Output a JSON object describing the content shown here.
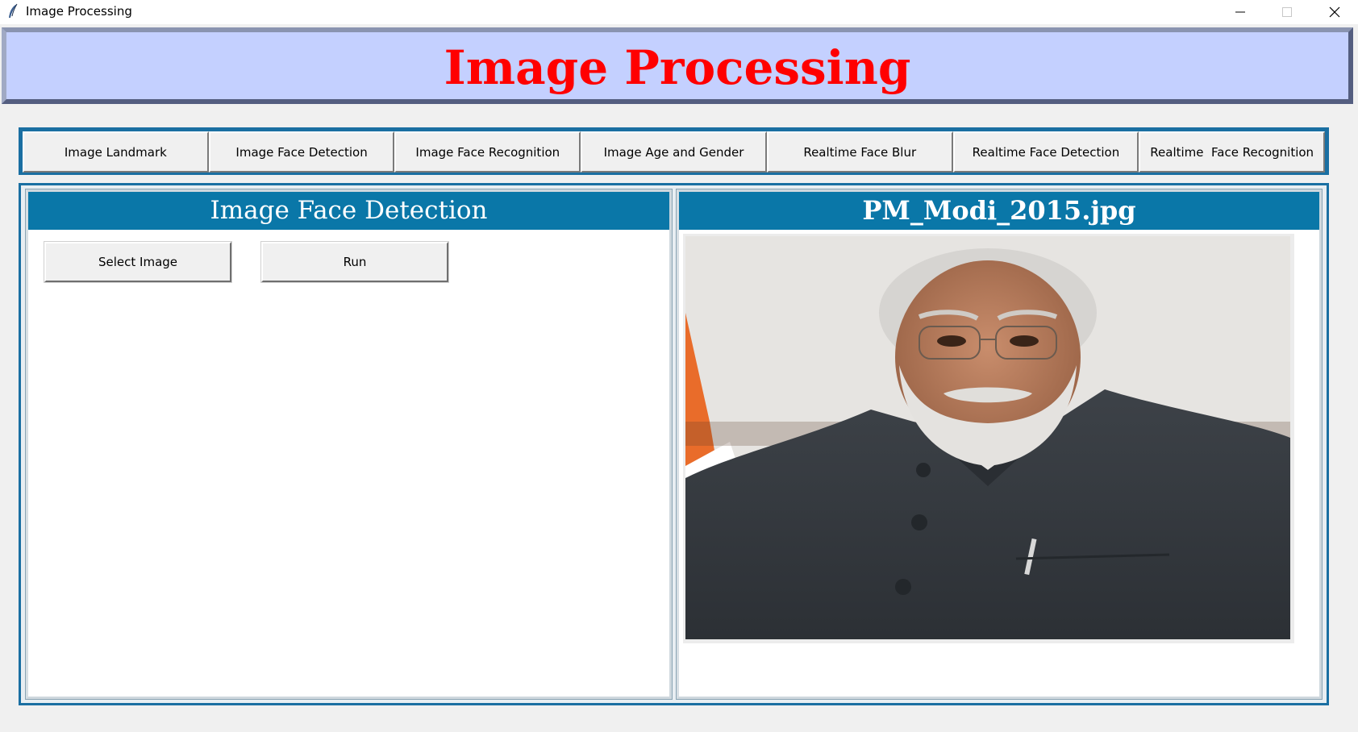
{
  "window": {
    "title": "Image Processing",
    "icon": "feather-icon",
    "controls": [
      "minimize-icon",
      "maximize-icon",
      "close-icon"
    ]
  },
  "banner": {
    "title": "Image Processing",
    "color": "#ff0000",
    "background": "#c4d0ff"
  },
  "tabs": [
    {
      "label": "Image Landmark"
    },
    {
      "label": "Image Face Detection"
    },
    {
      "label": "Image Face Recognition"
    },
    {
      "label": "Image Age and Gender"
    },
    {
      "label": "Realtime Face Blur"
    },
    {
      "label": "Realtime Face Detection"
    },
    {
      "label": "Realtime  Face Recognition"
    }
  ],
  "left_panel": {
    "header": "Image Face Detection",
    "buttons": {
      "select": "Select Image",
      "run": "Run"
    }
  },
  "right_panel": {
    "header": "PM_Modi_2015.jpg",
    "image": "portrait-photo"
  },
  "colors": {
    "accent": "#0a77a8",
    "frame": "#1a6fa2"
  }
}
